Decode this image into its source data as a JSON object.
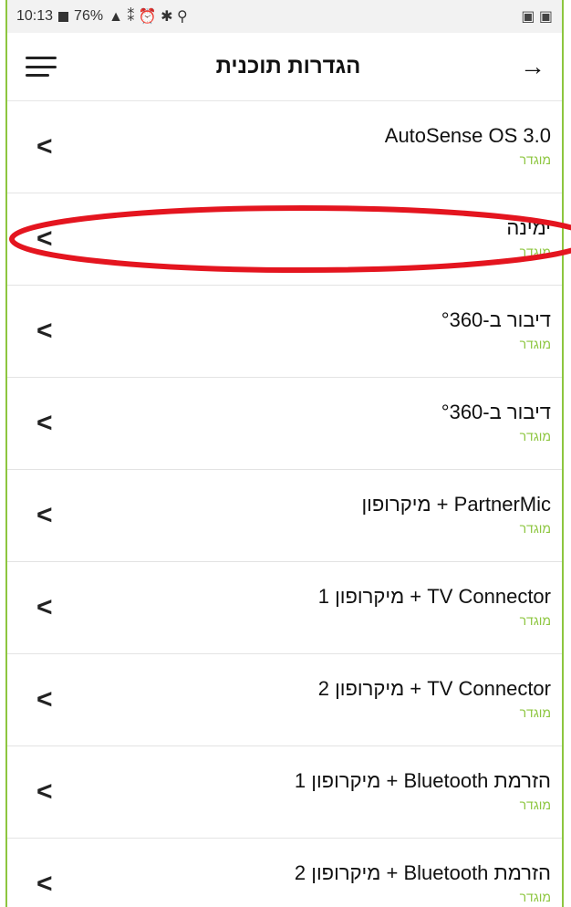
{
  "statusbar": {
    "time": "10:13",
    "battery": "76%",
    "icons": "▲ ⁑ ⏰ ✱ ⚲",
    "right_icons": "▣ ▣"
  },
  "appbar": {
    "title": "הגדרות תוכנית",
    "back_icon": "→",
    "menu_icon": "hamburger-icon"
  },
  "items": [
    {
      "name": "AutoSense OS 3.0",
      "status": "מוגדר"
    },
    {
      "name": "ימינה",
      "status": "מוגדר"
    },
    {
      "name": "דיבור ב-°360",
      "status": "מוגדר"
    },
    {
      "name": "דיבור ב-°360",
      "status": "מוגדר"
    },
    {
      "name": "PartnerMic + מיקרופון",
      "status": "מוגדר"
    },
    {
      "name": "TV Connector + מיקרופון 1",
      "status": "מוגדר"
    },
    {
      "name": "TV Connector + מיקרופון 2",
      "status": "מוגדר"
    },
    {
      "name": "הזרמת Bluetooth + מיקרופון 1",
      "status": "מוגדר"
    },
    {
      "name": "הזרמת Bluetooth + מיקרופון 2",
      "status": "מוגדר"
    }
  ],
  "colors": {
    "accent": "#8dc63f",
    "highlight": "#e4151f"
  }
}
